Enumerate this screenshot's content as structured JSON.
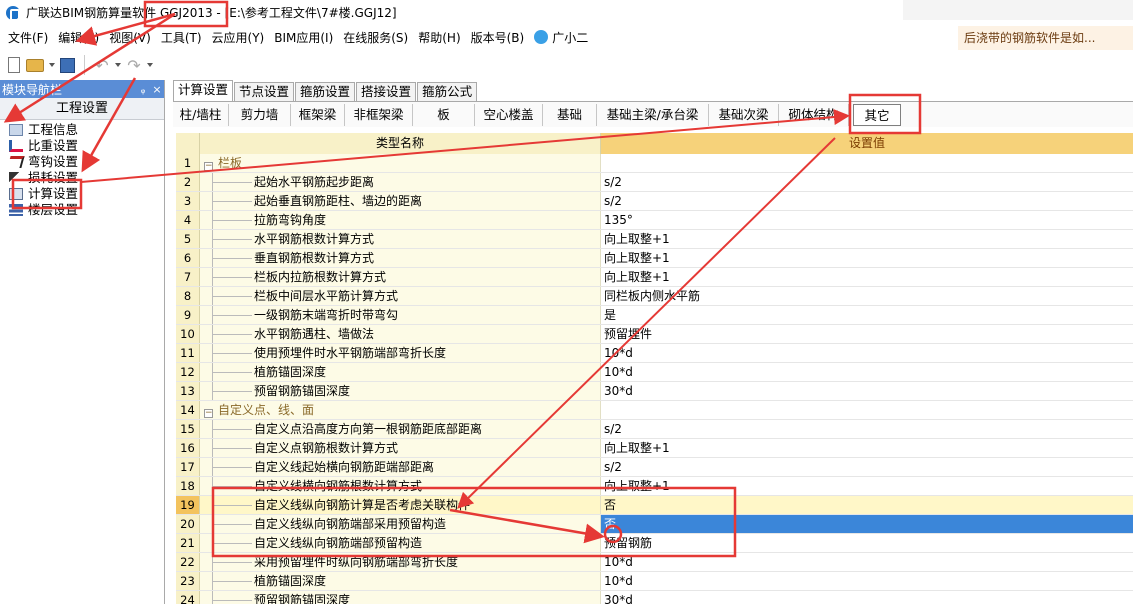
{
  "window": {
    "title": "广联达BIM钢筋算量软件 GGJ2013 - [E:\\参考工程文件\\7#楼.GGJ12]"
  },
  "menu": {
    "items": [
      "文件(F)",
      "编辑(E)",
      "视图(V)",
      "工具(T)",
      "云应用(Y)",
      "BIM应用(I)",
      "在线服务(S)",
      "帮助(H)",
      "版本号(B)",
      "广小二"
    ],
    "notice": "后浇带的钢筋软件是如..."
  },
  "left_panel": {
    "title": "模块导航栏",
    "pin": "ᵩ",
    "close": "×",
    "section": "工程设置",
    "items": [
      {
        "label": "工程信息",
        "icon": "info-icon"
      },
      {
        "label": "比重设置",
        "icon": "ratio-icon"
      },
      {
        "label": "弯钩设置",
        "icon": "hook-icon"
      },
      {
        "label": "损耗设置",
        "icon": "loss-icon"
      },
      {
        "label": "计算设置",
        "icon": "calc-icon"
      },
      {
        "label": "楼层设置",
        "icon": "floor-icon"
      }
    ]
  },
  "tabs": [
    "计算设置",
    "节点设置",
    "箍筋设置",
    "搭接设置",
    "箍筋公式"
  ],
  "subtabs": [
    "柱/墙柱",
    "剪力墙",
    "框架梁",
    "非框架梁",
    "板",
    "空心楼盖",
    "基础",
    "基础主梁/承台梁",
    "基础次梁",
    "砌体结构",
    "其它"
  ],
  "grid": {
    "col_name": "类型名称",
    "col_value": "设置值",
    "rows": [
      {
        "num": "1",
        "name": "栏板",
        "value": "",
        "group": true
      },
      {
        "num": "2",
        "name": "起始水平钢筋起步距离",
        "value": "s/2"
      },
      {
        "num": "3",
        "name": "起始垂直钢筋距柱、墙边的距离",
        "value": "s/2"
      },
      {
        "num": "4",
        "name": "拉筋弯钩角度",
        "value": "135°"
      },
      {
        "num": "5",
        "name": "水平钢筋根数计算方式",
        "value": "向上取整+1"
      },
      {
        "num": "6",
        "name": "垂直钢筋根数计算方式",
        "value": "向上取整+1"
      },
      {
        "num": "7",
        "name": "栏板内拉筋根数计算方式",
        "value": "向上取整+1"
      },
      {
        "num": "8",
        "name": "栏板中间层水平筋计算方式",
        "value": "同栏板内侧水平筋"
      },
      {
        "num": "9",
        "name": "一级钢筋末端弯折时带弯勾",
        "value": "是"
      },
      {
        "num": "10",
        "name": "水平钢筋遇柱、墙做法",
        "value": "预留埋件"
      },
      {
        "num": "11",
        "name": "使用预埋件时水平钢筋端部弯折长度",
        "value": "10*d"
      },
      {
        "num": "12",
        "name": "植筋锚固深度",
        "value": "10*d"
      },
      {
        "num": "13",
        "name": "预留钢筋锚固深度",
        "value": "30*d"
      },
      {
        "num": "14",
        "name": "自定义点、线、面",
        "value": "",
        "group": true
      },
      {
        "num": "15",
        "name": "自定义点沿高度方向第一根钢筋距底部距离",
        "value": "s/2"
      },
      {
        "num": "16",
        "name": "自定义点钢筋根数计算方式",
        "value": "向上取整+1"
      },
      {
        "num": "17",
        "name": "自定义线起始横向钢筋距端部距离",
        "value": "s/2"
      },
      {
        "num": "18",
        "name": "自定义线横向钢筋根数计算方式",
        "value": "向上取整+1"
      },
      {
        "num": "19",
        "name": "自定义线纵向钢筋计算是否考虑关联构件",
        "value": "否",
        "highlight": true
      },
      {
        "num": "20",
        "name": "自定义线纵向钢筋端部采用预留构造",
        "value": "否",
        "selected": true
      },
      {
        "num": "21",
        "name": "自定义线纵向钢筋端部预留构造",
        "value": "预留钢筋"
      },
      {
        "num": "22",
        "name": "采用预留埋件时纵向钢筋端部弯折长度",
        "value": "10*d"
      },
      {
        "num": "23",
        "name": "植筋锚固深度",
        "value": "10*d"
      },
      {
        "num": "24",
        "name": "预留钢筋锚固深度",
        "value": "30*d"
      }
    ]
  },
  "colors": {
    "annotation": "#e53935",
    "header_blue": "#5a8dd6",
    "selection": "#3b86d9",
    "value_header": "#f6d27a"
  }
}
